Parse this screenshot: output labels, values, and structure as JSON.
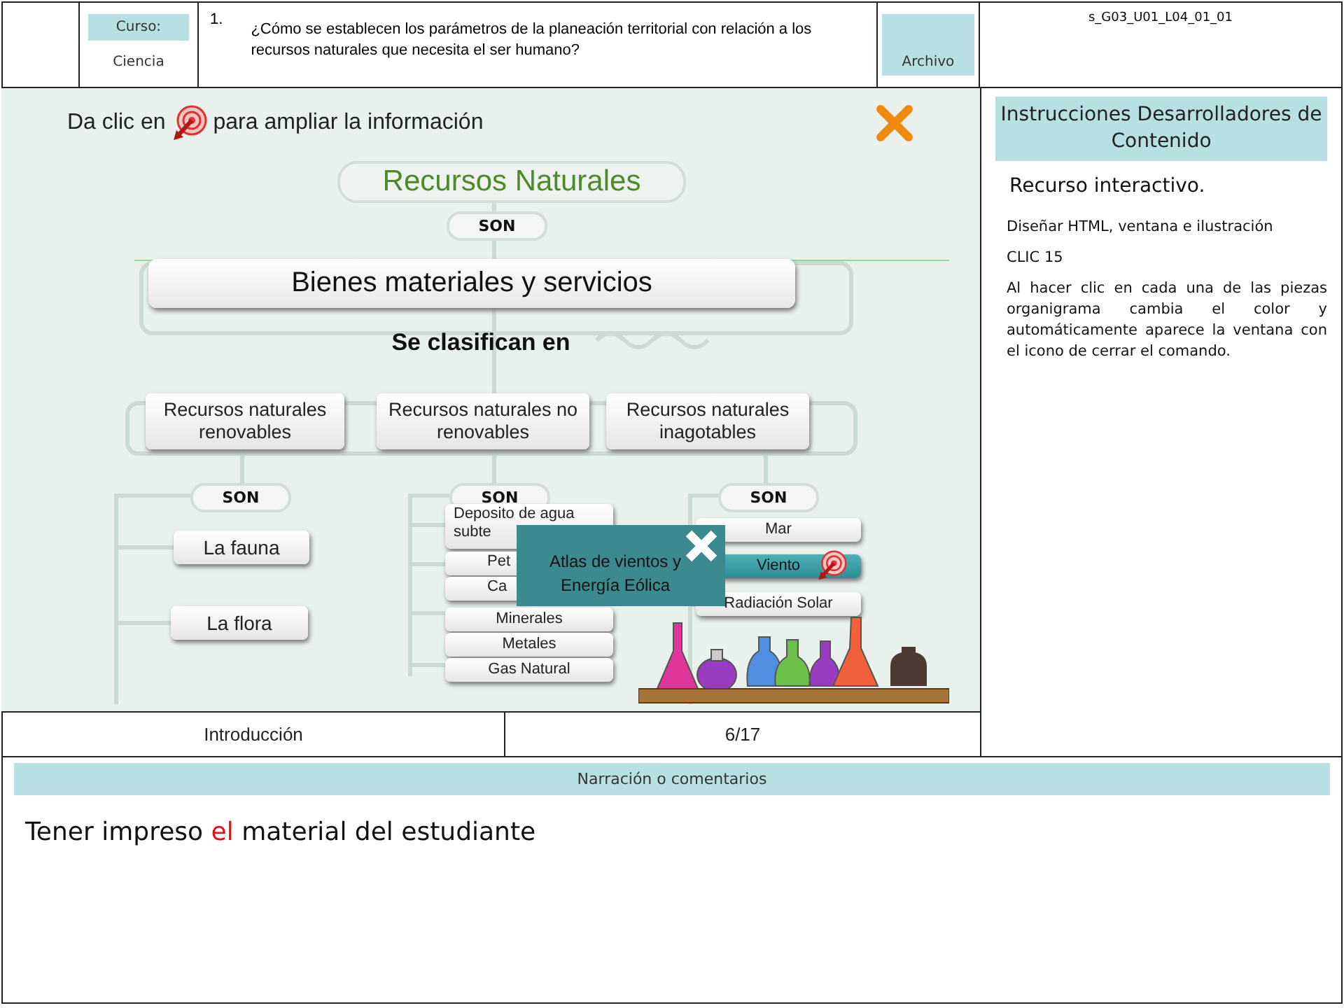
{
  "header": {
    "course_label": "Curso:",
    "course": "Ciencia",
    "number": "1.",
    "question": "¿Cómo se establecen los parámetros de la planeación territorial con relación a los recursos naturales que necesita el ser humano?",
    "file_label": "Archivo",
    "code": "s_G03_U01_L04_01_01"
  },
  "interactive": {
    "hint_before": "Da clic en",
    "hint_after": "para ampliar la información",
    "root": "Recursos Naturales",
    "connector": "SON",
    "level1": "Bienes materiales y servicios",
    "classify": "Se clasifican en",
    "categories": [
      {
        "label": "Recursos naturales renovables",
        "connector": "SON",
        "items": [
          {
            "label": "La fauna",
            "selected": false
          },
          {
            "label": "La flora",
            "selected": false
          }
        ]
      },
      {
        "label": "Recursos naturales no renovables",
        "connector": "SON",
        "items": [
          {
            "label": "Deposito de agua subte",
            "selected": false
          },
          {
            "label": "Pet",
            "selected": false
          },
          {
            "label": "Ca",
            "selected": false
          },
          {
            "label": "Minerales",
            "selected": false
          },
          {
            "label": "Metales",
            "selected": false
          },
          {
            "label": "Gas Natural",
            "selected": false
          }
        ]
      },
      {
        "label": "Recursos naturales inagotables",
        "connector": "SON",
        "items": [
          {
            "label": "Mar",
            "selected": false
          },
          {
            "label": "Viento",
            "selected": true
          },
          {
            "label": "Radiación Solar",
            "selected": false
          }
        ]
      }
    ],
    "popup": {
      "text": "Atlas de vientos y Energía Eólica"
    }
  },
  "footer_cells": [
    "Introducción",
    "6/17"
  ],
  "instructions": {
    "title": "Instrucciones Desarrolladores de Contenido",
    "subtitle": "Recurso interactivo.",
    "paragraphs": [
      "Diseñar HTML, ventana e ilustración",
      "CLIC 15",
      "Al hacer clic en cada una de las piezas organigrama cambia el color y automáticamente aparece la ventana con el icono de cerrar el comando."
    ]
  },
  "narration": {
    "title": "Narración o comentarios",
    "parts": [
      {
        "text": "Tener impreso ",
        "highlight": false
      },
      {
        "text": "el",
        "highlight": true
      },
      {
        "text": " material del estudiante",
        "highlight": false
      }
    ]
  }
}
